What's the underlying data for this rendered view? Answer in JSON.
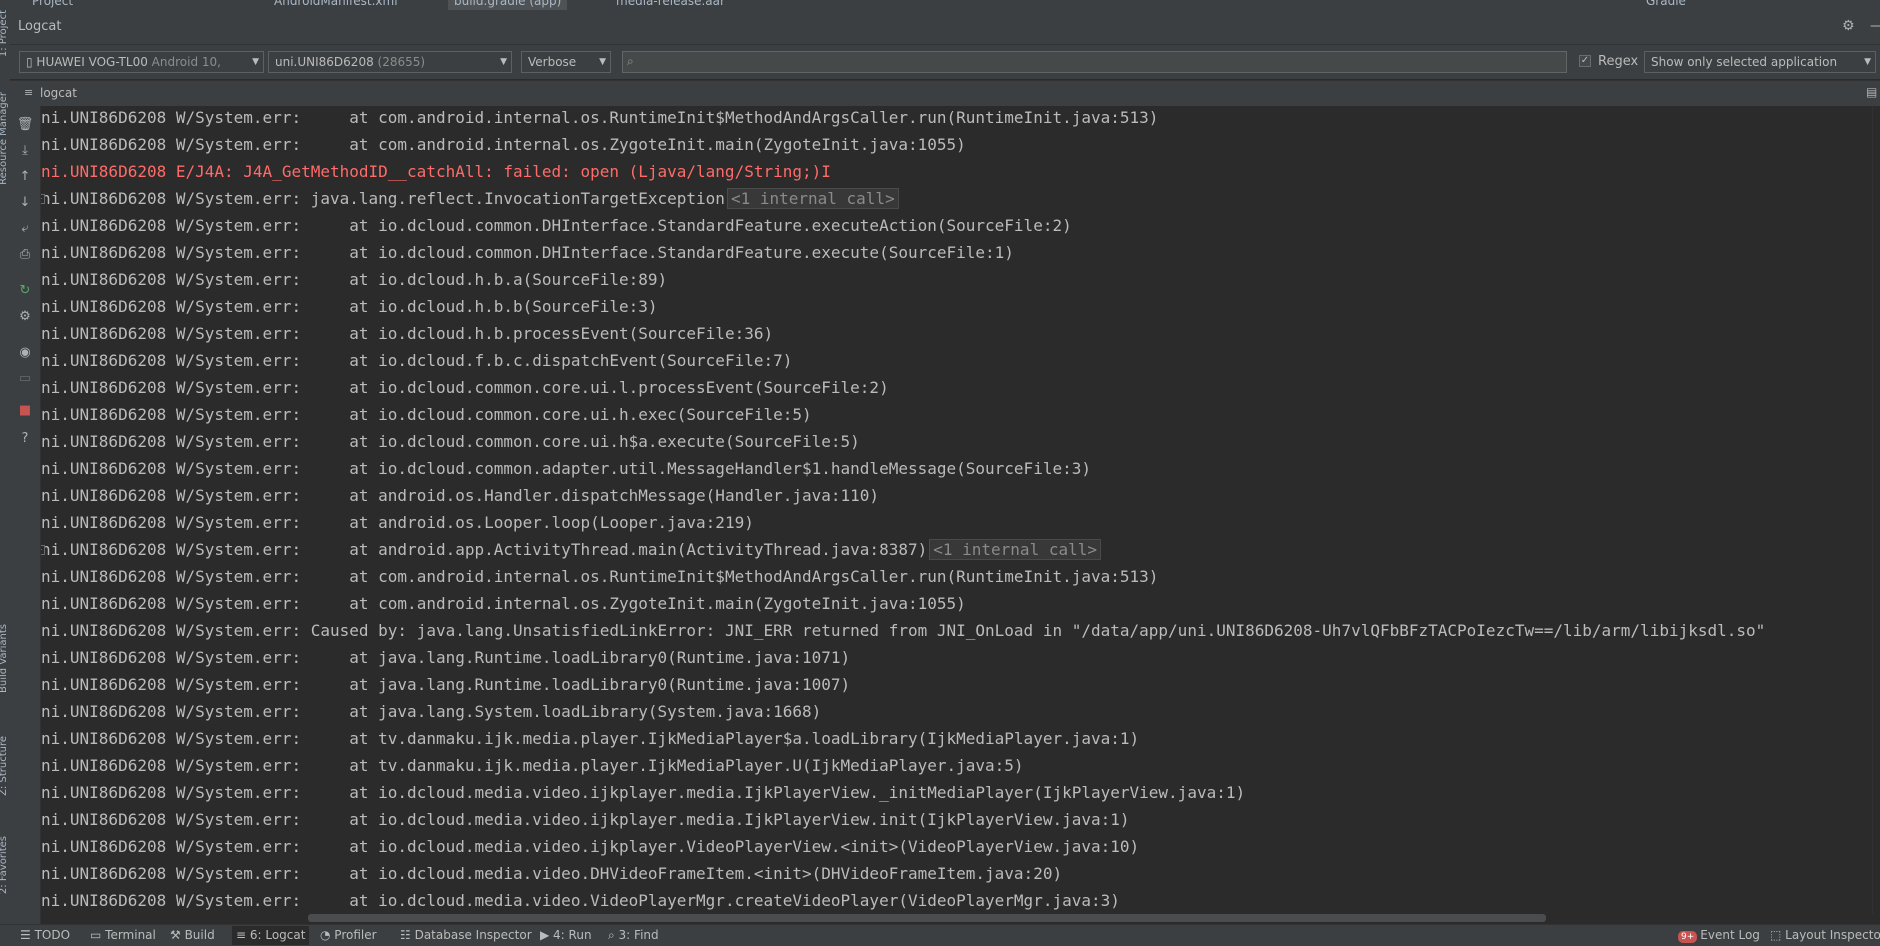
{
  "top_tabs": [
    {
      "label": "Project"
    },
    {
      "label": "AndroidManifest.xml"
    },
    {
      "label": "build.gradle (app)",
      "active": true
    },
    {
      "label": "media-release.aar"
    },
    {
      "label": "Gradle"
    }
  ],
  "left_stripe": {
    "project": "1: Project",
    "resource_manager": "Resource Manager",
    "build_variants": "Build Variants",
    "structure": "Z: Structure",
    "favorites": "2: Favorites"
  },
  "logcat_title": "Logcat",
  "toolbar": {
    "device_name": "HUAWEI VOG-TL00",
    "device_os": "Android 10,",
    "process_name": "uni.UNI86D6208",
    "process_pid": "(28655)",
    "log_level": "Verbose",
    "search_value": "",
    "search_placeholder": "",
    "regex_label": "Regex",
    "regex_checked": true,
    "filter_option": "Show only selected application"
  },
  "sub_tab_label": "logcat",
  "log_lines": [
    {
      "prefix": "ni.UNI86D6208 W/System.err:",
      "msg": "     at com.android.internal.os.RuntimeInit$MethodAndArgsCaller.run(RuntimeInit.java:513)"
    },
    {
      "prefix": "ni.UNI86D6208 W/System.err:",
      "msg": "     at com.android.internal.os.ZygoteInit.main(ZygoteInit.java:1055)"
    },
    {
      "prefix": "ni.UNI86D6208 E/J4A:",
      "msg": " J4A_GetMethodID__catchAll: failed: open (Ljava/lang/String;)I",
      "level": "error"
    },
    {
      "prefix": "ni.UNI86D6208 W/System.err:",
      "msg": " java.lang.reflect.InvocationTargetException",
      "hint": "<1 internal call>"
    },
    {
      "prefix": "ni.UNI86D6208 W/System.err:",
      "msg": "     at io.dcloud.common.DHInterface.StandardFeature.executeAction(SourceFile:2)"
    },
    {
      "prefix": "ni.UNI86D6208 W/System.err:",
      "msg": "     at io.dcloud.common.DHInterface.StandardFeature.execute(SourceFile:1)"
    },
    {
      "prefix": "ni.UNI86D6208 W/System.err:",
      "msg": "     at io.dcloud.h.b.a(SourceFile:89)"
    },
    {
      "prefix": "ni.UNI86D6208 W/System.err:",
      "msg": "     at io.dcloud.h.b.b(SourceFile:3)"
    },
    {
      "prefix": "ni.UNI86D6208 W/System.err:",
      "msg": "     at io.dcloud.h.b.processEvent(SourceFile:36)"
    },
    {
      "prefix": "ni.UNI86D6208 W/System.err:",
      "msg": "     at io.dcloud.f.b.c.dispatchEvent(SourceFile:7)"
    },
    {
      "prefix": "ni.UNI86D6208 W/System.err:",
      "msg": "     at io.dcloud.common.core.ui.l.processEvent(SourceFile:2)"
    },
    {
      "prefix": "ni.UNI86D6208 W/System.err:",
      "msg": "     at io.dcloud.common.core.ui.h.exec(SourceFile:5)"
    },
    {
      "prefix": "ni.UNI86D6208 W/System.err:",
      "msg": "     at io.dcloud.common.core.ui.h$a.execute(SourceFile:5)"
    },
    {
      "prefix": "ni.UNI86D6208 W/System.err:",
      "msg": "     at io.dcloud.common.adapter.util.MessageHandler$1.handleMessage(SourceFile:3)"
    },
    {
      "prefix": "ni.UNI86D6208 W/System.err:",
      "msg": "     at android.os.Handler.dispatchMessage(Handler.java:110)"
    },
    {
      "prefix": "ni.UNI86D6208 W/System.err:",
      "msg": "     at android.os.Looper.loop(Looper.java:219)"
    },
    {
      "prefix": "ni.UNI86D6208 W/System.err:",
      "msg": "     at android.app.ActivityThread.main(ActivityThread.java:8387)",
      "hint": "<1 internal call>"
    },
    {
      "prefix": "ni.UNI86D6208 W/System.err:",
      "msg": "     at com.android.internal.os.RuntimeInit$MethodAndArgsCaller.run(RuntimeInit.java:513)"
    },
    {
      "prefix": "ni.UNI86D6208 W/System.err:",
      "msg": "     at com.android.internal.os.ZygoteInit.main(ZygoteInit.java:1055)"
    },
    {
      "prefix": "ni.UNI86D6208 W/System.err:",
      "msg": " Caused by: java.lang.UnsatisfiedLinkError: JNI_ERR returned from JNI_OnLoad in \"/data/app/uni.UNI86D6208-Uh7vlQFbBFzTACPoIezcTw==/lib/arm/libijksdl.so\""
    },
    {
      "prefix": "ni.UNI86D6208 W/System.err:",
      "msg": "     at java.lang.Runtime.loadLibrary0(Runtime.java:1071)"
    },
    {
      "prefix": "ni.UNI86D6208 W/System.err:",
      "msg": "     at java.lang.Runtime.loadLibrary0(Runtime.java:1007)"
    },
    {
      "prefix": "ni.UNI86D6208 W/System.err:",
      "msg": "     at java.lang.System.loadLibrary(System.java:1668)"
    },
    {
      "prefix": "ni.UNI86D6208 W/System.err:",
      "msg": "     at tv.danmaku.ijk.media.player.IjkMediaPlayer$a.loadLibrary(IjkMediaPlayer.java:1)"
    },
    {
      "prefix": "ni.UNI86D6208 W/System.err:",
      "msg": "     at tv.danmaku.ijk.media.player.IjkMediaPlayer.U(IjkMediaPlayer.java:5)"
    },
    {
      "prefix": "ni.UNI86D6208 W/System.err:",
      "msg": "     at io.dcloud.media.video.ijkplayer.media.IjkPlayerView._initMediaPlayer(IjkPlayerView.java:1)"
    },
    {
      "prefix": "ni.UNI86D6208 W/System.err:",
      "msg": "     at io.dcloud.media.video.ijkplayer.media.IjkPlayerView.init(IjkPlayerView.java:1)"
    },
    {
      "prefix": "ni.UNI86D6208 W/System.err:",
      "msg": "     at io.dcloud.media.video.ijkplayer.VideoPlayerView.<init>(VideoPlayerView.java:10)"
    },
    {
      "prefix": "ni.UNI86D6208 W/System.err:",
      "msg": "     at io.dcloud.media.video.DHVideoFrameItem.<init>(DHVideoFrameItem.java:20)"
    },
    {
      "prefix": "ni.UNI86D6208 W/System.err:",
      "msg": "     at io.dcloud.media.video.VideoPlayerMgr.createVideoPlayer(VideoPlayerMgr.java:3)"
    }
  ],
  "bottom_tabs": [
    {
      "icon": "list-icon",
      "label": "TODO"
    },
    {
      "icon": "terminal-icon",
      "label": "Terminal"
    },
    {
      "icon": "hammer-icon",
      "label": "Build"
    },
    {
      "icon": "logcat-icon",
      "label": "6: Logcat",
      "active": true
    },
    {
      "icon": "profiler-icon",
      "label": "Profiler"
    },
    {
      "icon": "database-icon",
      "label": "Database Inspector"
    },
    {
      "icon": "run-icon",
      "label": "4: Run"
    },
    {
      "icon": "find-icon",
      "label": "3: Find"
    }
  ],
  "event_log": {
    "badge": "9+",
    "label": "Event Log"
  },
  "layout_inspector": "Layout Inspector",
  "colors": {
    "error": "#ff6b68",
    "text": "#bbbbbb",
    "background": "#2b2b2b",
    "panel": "#3c3f41"
  }
}
